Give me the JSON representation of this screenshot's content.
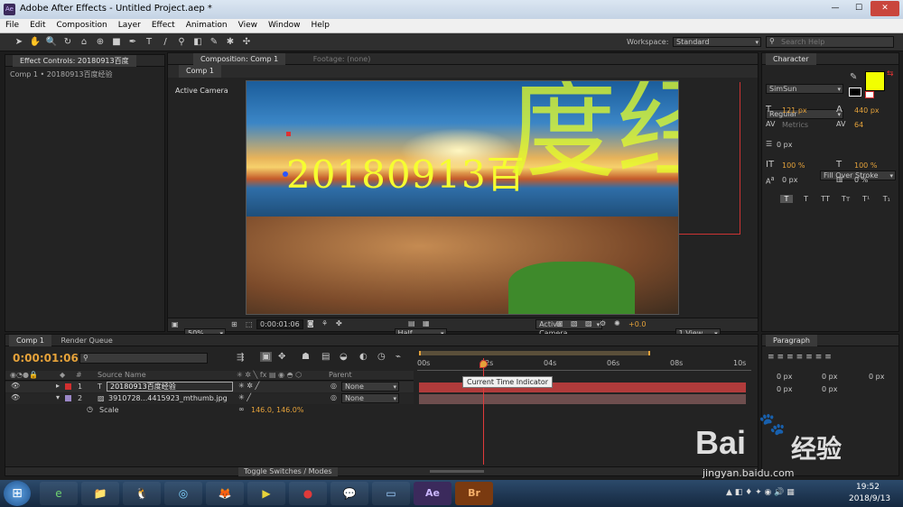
{
  "window": {
    "title": "Adobe After Effects - Untitled Project.aep *",
    "app_badge": "Ae",
    "controls": {
      "minimize": "—",
      "maximize": "☐",
      "close": "✕"
    }
  },
  "menu": [
    "File",
    "Edit",
    "Composition",
    "Layer",
    "Effect",
    "Animation",
    "View",
    "Window",
    "Help"
  ],
  "toolbar": {
    "workspace_label": "Workspace:",
    "workspace_value": "Standard",
    "search_placeholder": "Search Help"
  },
  "effect_controls": {
    "tab": "Effect Controls: 20180913百度",
    "breadcrumb": "Comp 1 • 20180913百度经验"
  },
  "composition": {
    "tab": "Composition: Comp 1",
    "footage_tab": "Footage: (none)",
    "subtab": "Comp 1",
    "camera_label": "Active Camera",
    "overlay_text": "20180913百",
    "overlay_big": "度经",
    "footer": {
      "zoom": "50%",
      "timecode": "0:00:01:06",
      "resolution": "Half",
      "camera": "Active Camera",
      "views": "1 View",
      "exposure": "+0.0"
    }
  },
  "character": {
    "tab": "Character",
    "font": "SimSun",
    "style": "Regular",
    "size": "121 px",
    "leading": "440 px",
    "kerning": "Metrics",
    "tracking": "64",
    "stroke_width": "0 px",
    "stroke_mode": "Fill Over Stroke",
    "vscale": "100 %",
    "hscale": "100 %",
    "baseline": "0 px",
    "tsume": "0 %",
    "fill_color": "#f2ff00",
    "styles": [
      "T",
      "T",
      "TT",
      "Tт",
      "T¹",
      "T₁"
    ]
  },
  "paragraph": {
    "tab": "Paragraph",
    "values": [
      "0 px",
      "0 px",
      "0 px",
      "0 px",
      "0 px"
    ]
  },
  "timeline": {
    "tabs": [
      "Comp 1",
      "Render Queue"
    ],
    "current_time": "0:00:01:06",
    "columns": {
      "num": "#",
      "source": "Source Name",
      "parent": "Parent"
    },
    "layers": [
      {
        "num": "1",
        "name": "20180913百度经验",
        "parent": "None",
        "color": "#d12f2f"
      },
      {
        "num": "2",
        "name": "3910728...4415923_mthumb.jpg",
        "parent": "None",
        "color": "#9b87c7"
      }
    ],
    "scale_prop": {
      "name": "Scale",
      "value": "146.0, 146.0%"
    },
    "ruler": [
      "00s",
      "02s",
      "04s",
      "06s",
      "08s",
      "10s"
    ],
    "playhead_pos": 0.12,
    "tooltip": "Current Time Indicator",
    "footer": "Toggle Switches / Modes"
  },
  "watermark": {
    "brand": "Bai",
    "brand_cn": "经验",
    "url": "jingyan.baidu.com"
  },
  "taskbar": {
    "time": "19:52",
    "date": "2018/9/13",
    "apps": [
      "e",
      "📁",
      "🐧",
      "◎",
      "🦊",
      "▶",
      "●",
      "💬",
      "▭",
      "Ae",
      "Br"
    ]
  }
}
